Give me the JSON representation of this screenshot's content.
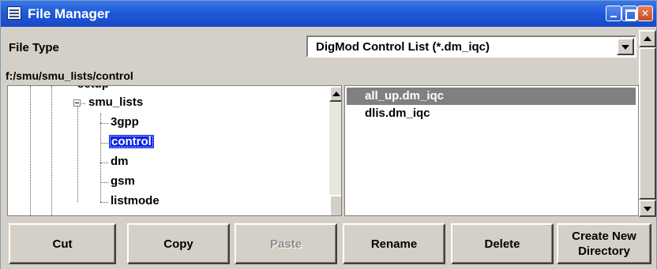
{
  "window": {
    "title": "File Manager"
  },
  "file_type": {
    "label": "File Type",
    "selected": "DigMod Control List (*.dm_iqc)"
  },
  "path": "f:/smu/smu_lists/control",
  "tree": {
    "clipped_top": "setup",
    "parent": "smu_lists",
    "children": [
      "3gpp",
      "control",
      "dm",
      "gsm",
      "listmode"
    ],
    "selected": "control"
  },
  "files": [
    {
      "name": "all_up.dm_iqc",
      "selected": true
    },
    {
      "name": "dlis.dm_iqc",
      "selected": false
    }
  ],
  "buttons": {
    "cut": "Cut",
    "copy": "Copy",
    "paste": "Paste",
    "rename": "Rename",
    "delete": "Delete",
    "create_new_dir_line1": "Create New",
    "create_new_dir_line2": "Directory"
  },
  "colors": {
    "title_bar": "#1f5ad8",
    "tree_selection": "#0a24e8",
    "file_selection": "#808080",
    "panel": "#d4d0c8"
  },
  "icons": [
    "app-icon",
    "minimize-icon",
    "maximize-icon",
    "close-icon",
    "dropdown-arrow-icon",
    "scroll-up-icon",
    "scroll-down-icon",
    "collapse-icon"
  ]
}
